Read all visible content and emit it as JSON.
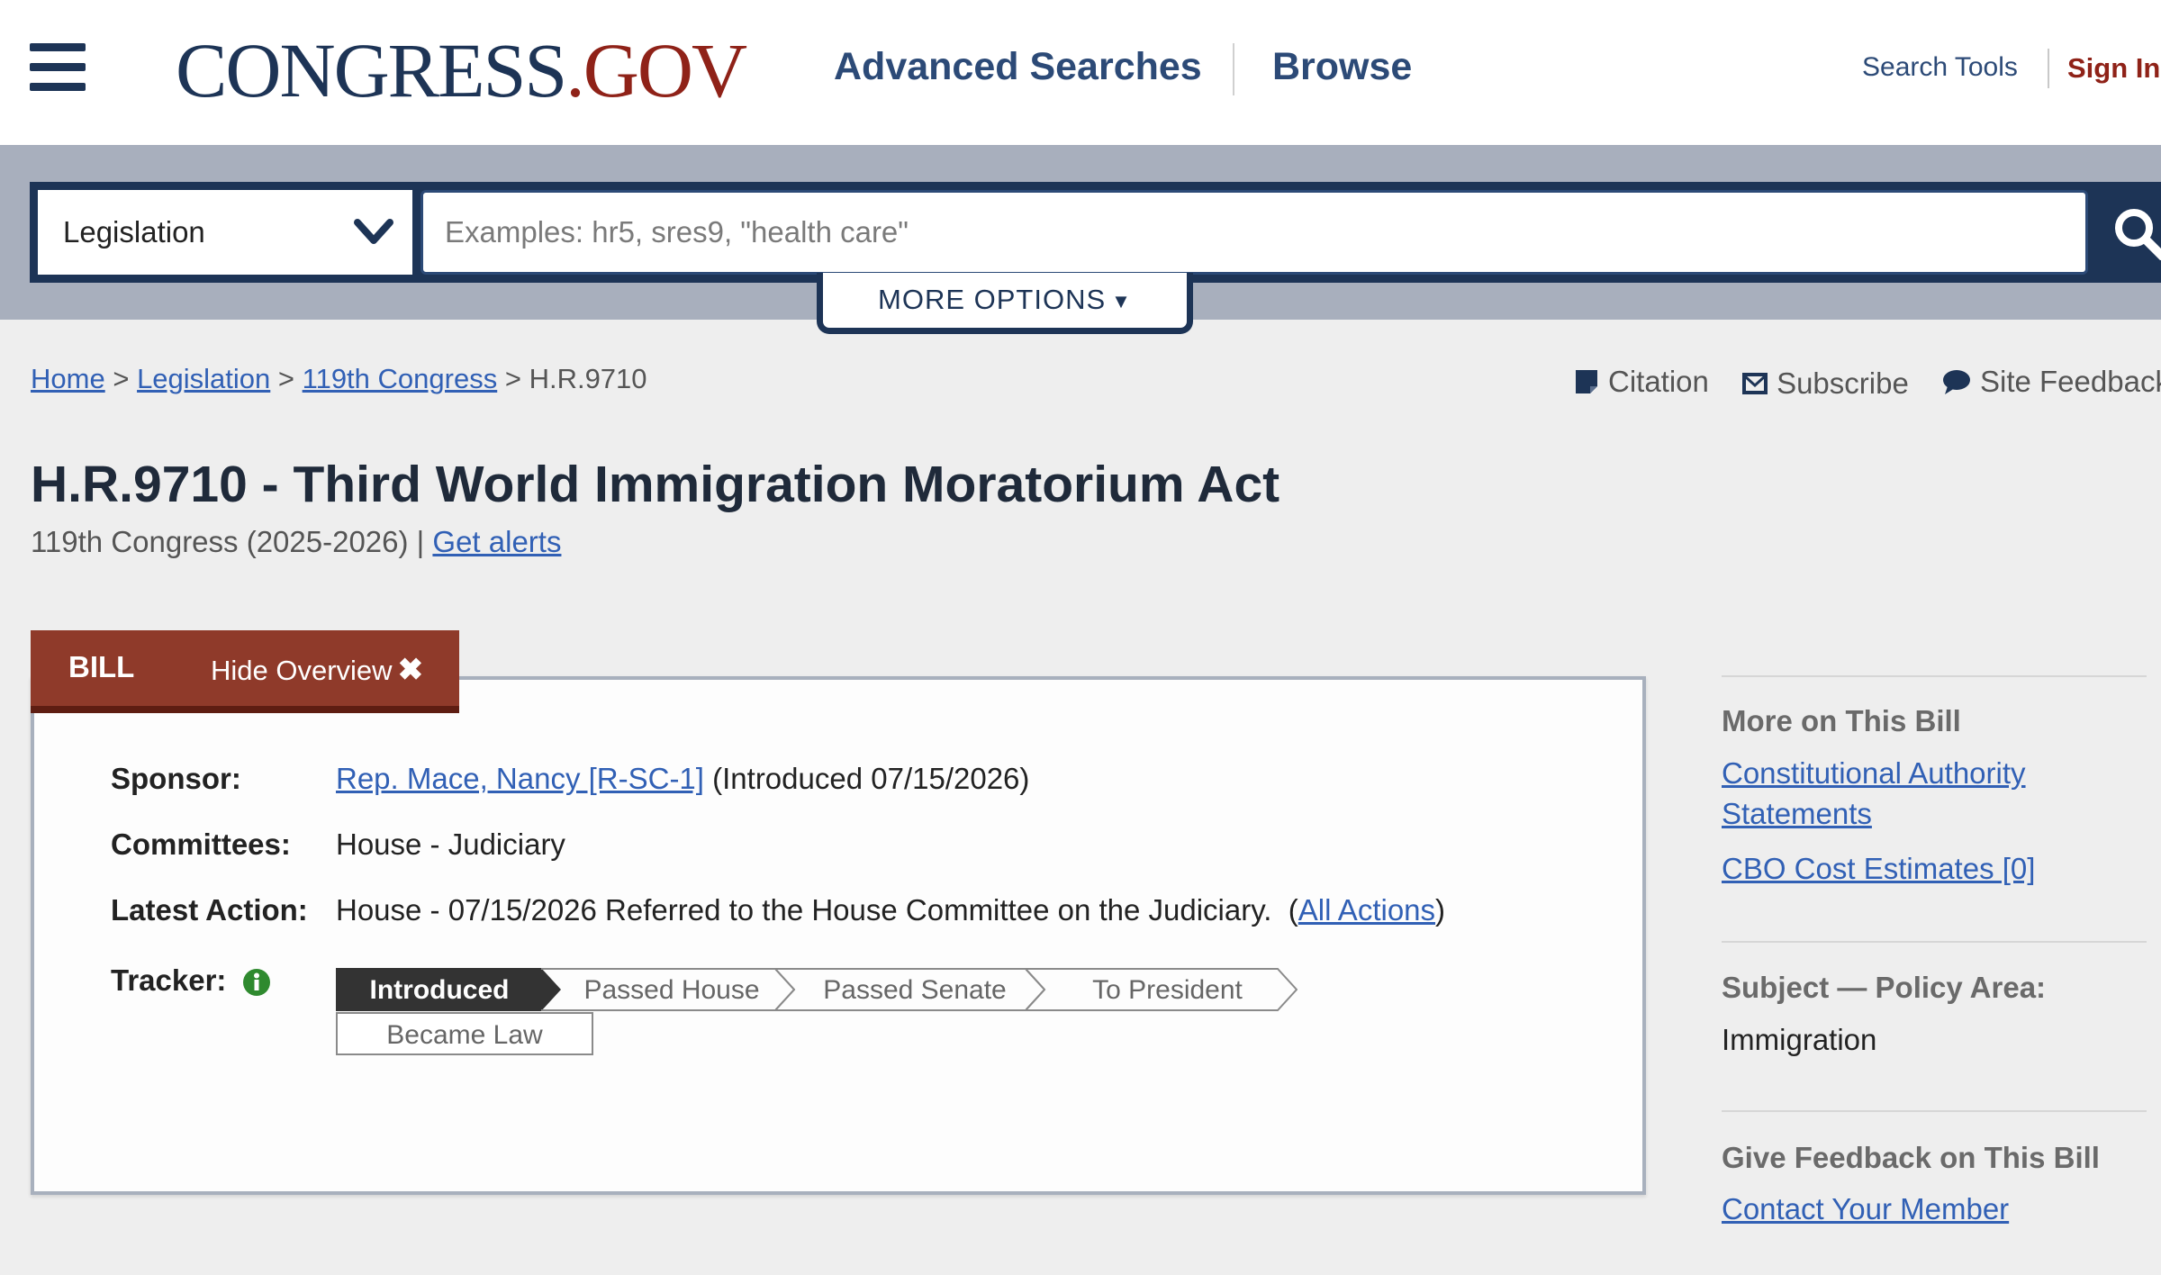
{
  "header": {
    "logo_main": "CONGRESS",
    "logo_dot": ".",
    "logo_gov": "GOV",
    "nav": [
      "Advanced Searches",
      "Browse"
    ],
    "search_tools": "Search Tools",
    "sign_in": "Sign In"
  },
  "search": {
    "scope_selected": "Legislation",
    "placeholder": "Examples: hr5, sres9, \"health care\"",
    "more_options": "MORE OPTIONS"
  },
  "breadcrumb": {
    "items": [
      "Home",
      "Legislation",
      "119th Congress"
    ],
    "separator": ">",
    "current": "H.R.9710"
  },
  "utilities": [
    "Citation",
    "Subscribe",
    "Site Feedback"
  ],
  "bill": {
    "title": "H.R.9710 - Third World Immigration Moratorium Act",
    "congress": "119th Congress (2025-2026) |",
    "get_alerts": "Get alerts",
    "tab_label": "BILL",
    "hide_overview": "Hide Overview",
    "sponsor_label": "Sponsor:",
    "sponsor_name": "Rep. Mace, Nancy [R-SC-1]",
    "sponsor_intro": "(Introduced 07/15/2026)",
    "committees_label": "Committees:",
    "committees": "House - Judiciary",
    "latest_action_label": "Latest Action:",
    "latest_action": "House - 07/15/2026 Referred to the House Committee on the Judiciary.",
    "all_actions": "All Actions",
    "tracker_label": "Tracker:",
    "tracker_steps": [
      "Introduced",
      "Passed House",
      "Passed Senate",
      "To President",
      "Became Law"
    ],
    "tracker_current": "Introduced"
  },
  "sidebar": {
    "more_heading": "More on This Bill",
    "more_links": [
      "Constitutional Authority Statements",
      "CBO Cost Estimates [0]"
    ],
    "subject_heading": "Subject — Policy Area:",
    "subject_value": "Immigration",
    "feedback_heading": "Give Feedback on This Bill",
    "feedback_link": "Contact Your Member"
  },
  "colors": {
    "navy": "#1d3456",
    "brand_red": "#8f2218",
    "link_blue": "#3160b5",
    "tab_red": "#8f3a2a",
    "tracker_active": "#333333",
    "info_green": "#2f8a2f"
  },
  "icons": [
    "hamburger-menu-icon",
    "chevron-down-icon",
    "search-icon",
    "citation-icon",
    "envelope-icon",
    "speech-bubble-icon",
    "close-icon",
    "info-icon"
  ]
}
